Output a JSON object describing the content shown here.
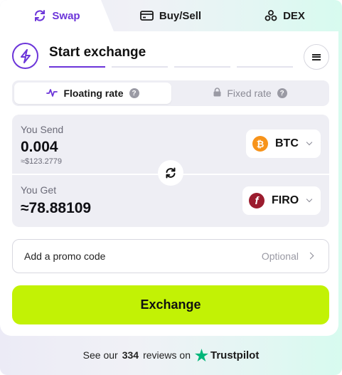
{
  "tabs": [
    {
      "label": "Swap",
      "icon": "swap-arrows-icon",
      "active": true
    },
    {
      "label": "Buy/Sell",
      "icon": "card-icon",
      "active": false
    },
    {
      "label": "DEX",
      "icon": "dex-nodes-icon",
      "active": false
    }
  ],
  "header": {
    "title": "Start exchange",
    "steps_total": 4,
    "steps_active": 1
  },
  "rate": {
    "floating_label": "Floating rate",
    "fixed_label": "Fixed rate",
    "selected": "floating",
    "help_glyph": "?"
  },
  "send": {
    "label": "You Send",
    "amount": "0.004",
    "fiat": "≈$123.2779",
    "coin": "BTC",
    "coin_glyph": "₿",
    "coin_color": "#f7931a"
  },
  "get": {
    "label": "You Get",
    "amount": "≈78.88109",
    "coin": "FIRO",
    "coin_glyph": "f",
    "coin_color": "#9b1c2e"
  },
  "promo": {
    "label": "Add a promo code",
    "hint": "Optional"
  },
  "exchange_button": "Exchange",
  "trustpilot": {
    "prefix": "See our",
    "count": "334",
    "suffix": "reviews on",
    "brand": "Trustpilot",
    "star_color": "#00b67a"
  },
  "colors": {
    "accent": "#6c35d9",
    "cta": "#c2f205"
  }
}
